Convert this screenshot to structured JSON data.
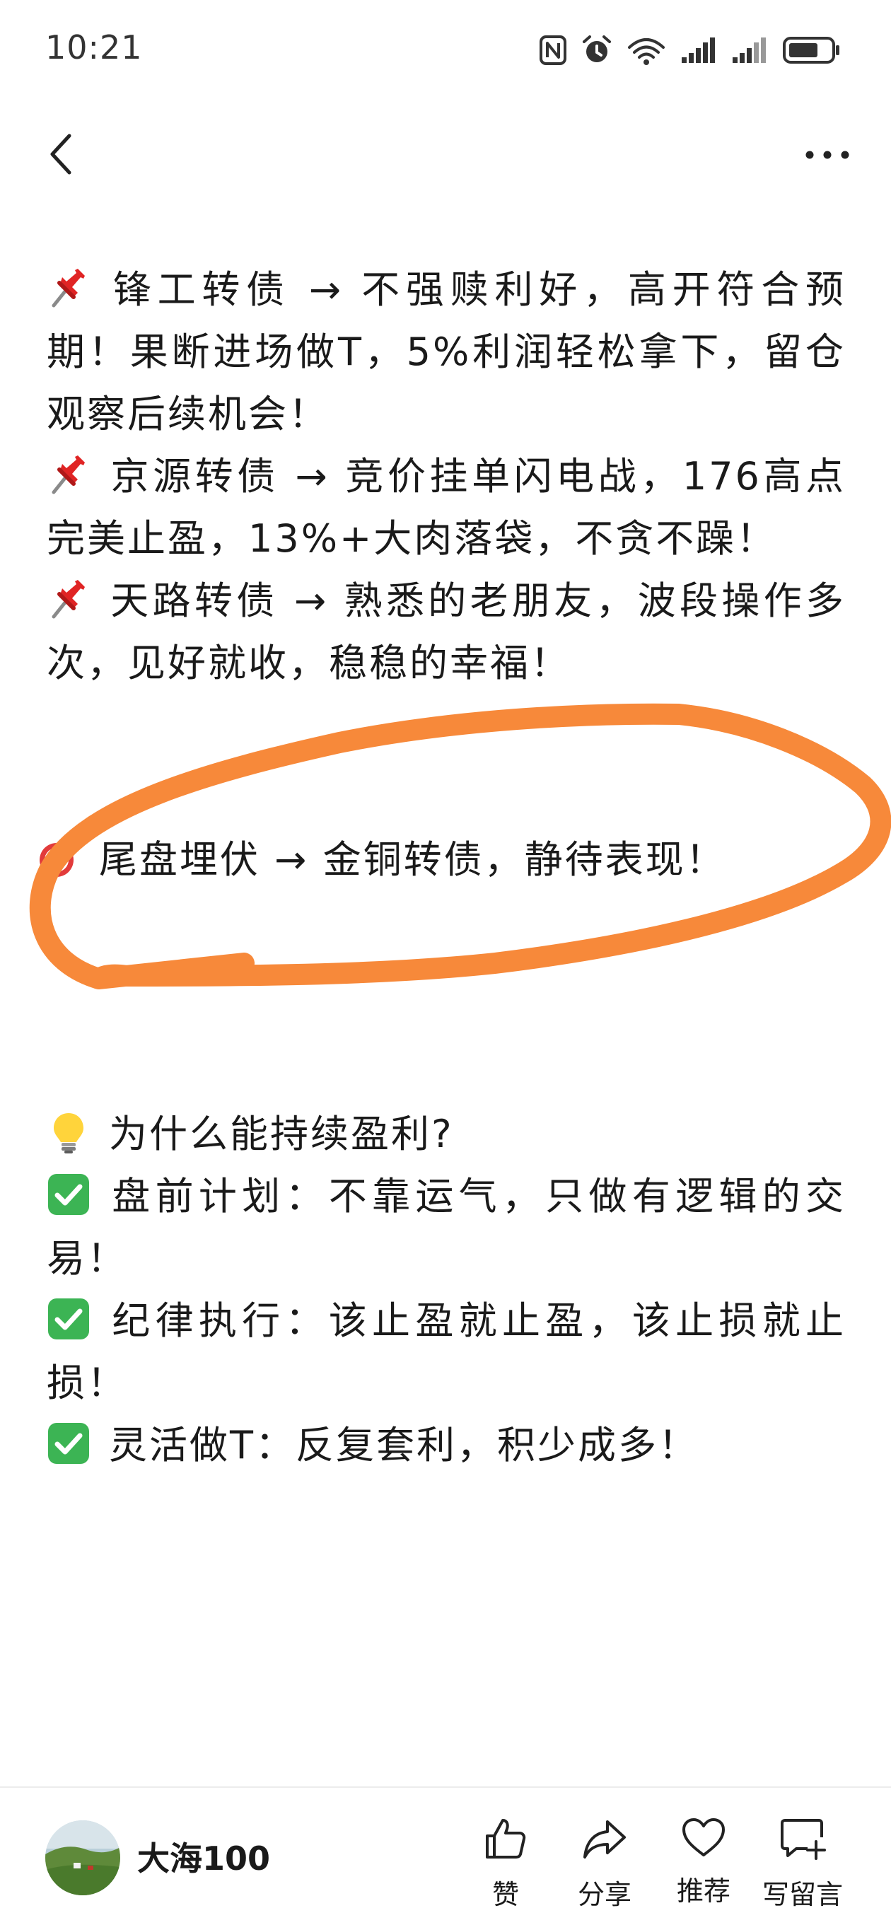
{
  "status_bar": {
    "time": "10:21",
    "icons": [
      "nfc-icon",
      "alarm-icon",
      "wifi-6-icon",
      "signal-icon",
      "signal-icon",
      "battery-icon"
    ]
  },
  "nav": {
    "back_icon": "chevron-left-icon",
    "more_icon": "more-dots-icon"
  },
  "article": {
    "p1": "锋工转债 → 不强赎利好，高开符合预期！果断进场做T，5%利润轻松拿下，留仓观察后续机会！",
    "p2": "京源转债 → 竞价挂单闪电战，176高点完美止盈，13%+大肉落袋，不贪不躁！",
    "p3": "天路转债 → 熟悉的老朋友，波段操作多次，见好就收，稳稳的幸福！",
    "highlight": "尾盘埋伏 → 金铜转债，静待表现！",
    "why_title": "为什么能持续盈利?",
    "c1": "盘前计划：不靠运气，只做有逻辑的交易！",
    "c2": "纪律执行：该止盈就止盈，该止损就止损！",
    "c3": "灵活做T：反复套利，积少成多！",
    "emojis": [
      "pushpin",
      "pushpin",
      "pushpin",
      "direct-hit",
      "light-bulb",
      "check-mark-button"
    ],
    "annotation_color": "#f7893a"
  },
  "bottom_bar": {
    "author": "大海100",
    "actions": {
      "like": "赞",
      "share": "分享",
      "recommend": "推荐",
      "comment": "写留言"
    }
  }
}
